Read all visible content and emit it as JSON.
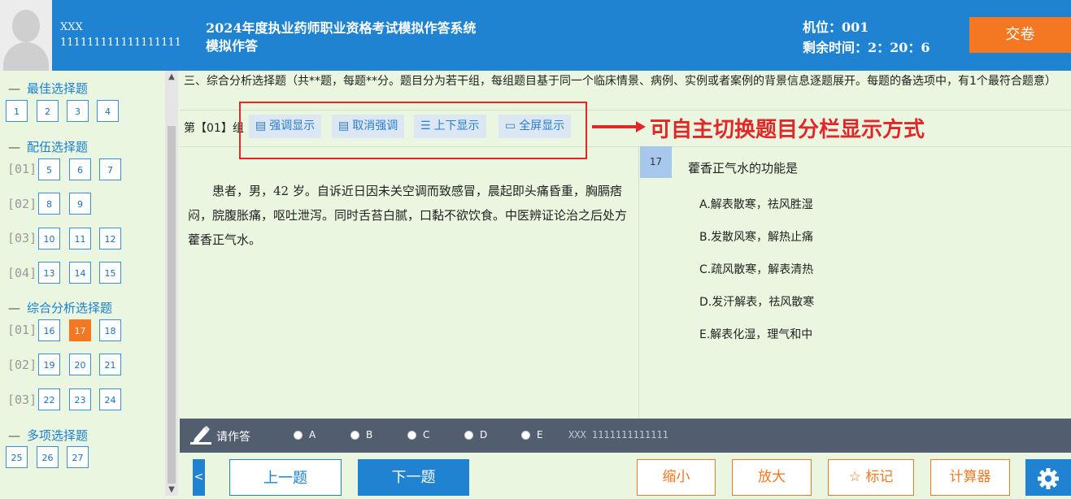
{
  "header": {
    "user_name": "XXX",
    "user_id": "111111111111111111",
    "system_title": "2024年度执业药师职业资格考试模拟作答系统",
    "mode": "模拟作答",
    "seat": "机位：001",
    "time_remaining": "剩余时间：2：20：6",
    "submit_label": "交卷"
  },
  "sidebar": {
    "sections": [
      {
        "title": "最佳选择题",
        "groups": [
          {
            "label": "",
            "items": [
              "1",
              "2",
              "3",
              "4"
            ]
          }
        ]
      },
      {
        "title": "配伍选择题",
        "groups": [
          {
            "label": "[01]",
            "items": [
              "5",
              "6",
              "7"
            ]
          },
          {
            "label": "[02]",
            "items": [
              "8",
              "9"
            ]
          },
          {
            "label": "[03]",
            "items": [
              "10",
              "11",
              "12"
            ]
          },
          {
            "label": "[04]",
            "items": [
              "13",
              "14",
              "15"
            ]
          }
        ]
      },
      {
        "title": "综合分析选择题",
        "groups": [
          {
            "label": "[01]",
            "items": [
              "16",
              "17",
              "18"
            ]
          },
          {
            "label": "[02]",
            "items": [
              "19",
              "20",
              "21"
            ]
          },
          {
            "label": "[03]",
            "items": [
              "22",
              "23",
              "24"
            ]
          }
        ]
      },
      {
        "title": "多项选择题",
        "groups": [
          {
            "label": "",
            "items": [
              "25",
              "26",
              "27"
            ]
          }
        ]
      }
    ],
    "current_question": "17"
  },
  "instructions": "三、综合分析选择题（共**题，每题**分。题目分为若干组，每组题目基于同一个临床情景、病例、实例或者案例的背景信息逐题展开。每题的备选项中，有1个最符合题意）",
  "group_title": "第【01】组",
  "toolbar": {
    "emphasize": "强调显示",
    "cancel_emphasize": "取消强调",
    "vertical": "上下显示",
    "fullscreen": "全屏显示"
  },
  "annotation": "可自主切换题目分栏显示方式",
  "passage": "患者，男，42 岁。自诉近日因未关空调而致感冒，晨起即头痛昏重，胸膈痞闷，脘腹胀痛，呕吐泄泻。同时舌苔白腻，口黏不欲饮食。中医辨证论治之后处方藿香正气水。",
  "question": {
    "number": "17",
    "stem": "藿香正气水的功能是",
    "options": [
      "A.解表散寒，祛风胜湿",
      "B.发散风寒，解热止痛",
      "C.疏风散寒，解表清热",
      "D.发汗解表，祛风散寒",
      "E.解表化湿，理气和中"
    ]
  },
  "answer_bar": {
    "label": "请作答",
    "choices": [
      "A",
      "B",
      "C",
      "D",
      "E"
    ],
    "extra": "XXX 1111111111111"
  },
  "nav": {
    "prev_arrow": "<",
    "prev": "上一题",
    "next": "下一题",
    "zoom_out": "缩小",
    "zoom_in": "放大",
    "mark": "标记",
    "calculator": "计算器"
  },
  "colors": {
    "header_bg": "#1f83d2",
    "accent_orange": "#f47821",
    "content_bg": "#eaf6df",
    "annotation_red": "#e02828"
  }
}
